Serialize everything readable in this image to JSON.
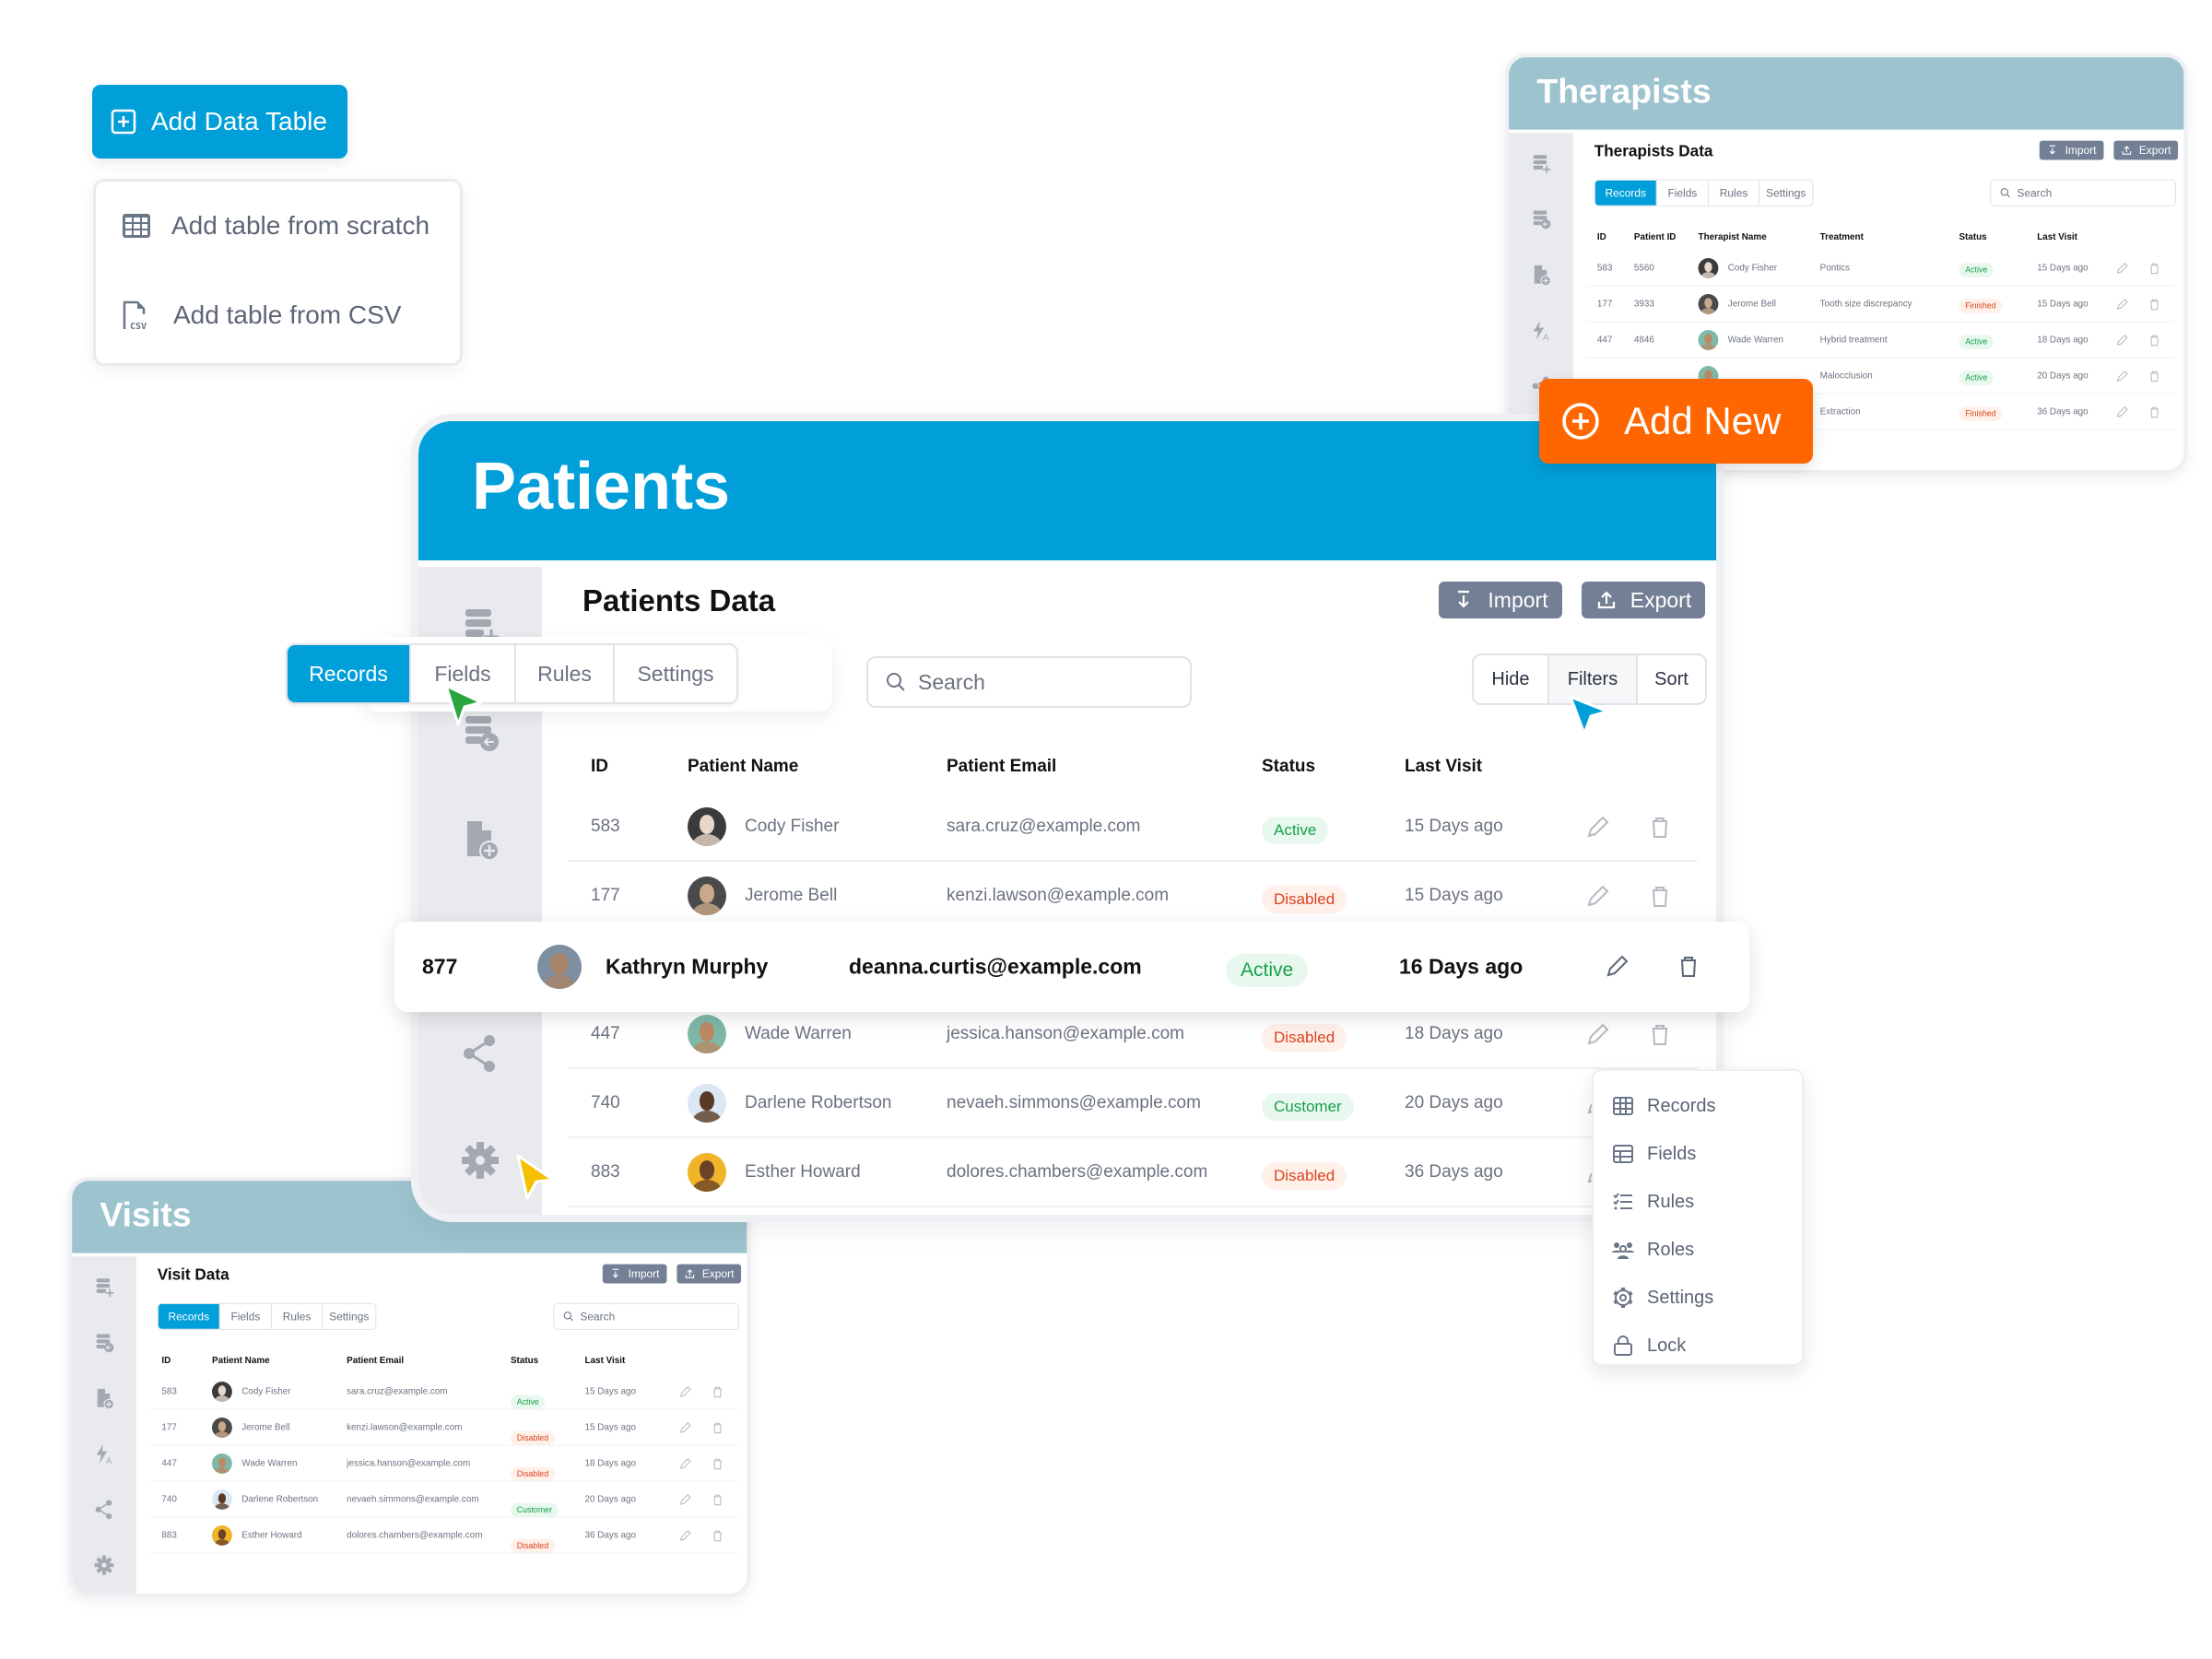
{
  "colors": {
    "primary": "#009fd9",
    "mini_header": "#9dc3cf",
    "accent_orange": "#ff6600",
    "secondary_button": "#737f94",
    "status_green": "#16a04a",
    "status_red": "#d9441f"
  },
  "add_table": {
    "label": "Add Data Table",
    "icon": "plus-square-icon",
    "menu": [
      {
        "label": "Add table from scratch",
        "icon": "table-grid-icon"
      },
      {
        "label": "Add table from CSV",
        "icon": "csv-file-icon"
      }
    ]
  },
  "add_new": {
    "label": "Add New",
    "icon": "plus-circle-icon"
  },
  "panels": {
    "therapists": {
      "title": "Therapists",
      "data_title": "Therapists Data",
      "import": "Import",
      "export": "Export",
      "tabs": [
        "Records",
        "Fields",
        "Rules",
        "Settings"
      ],
      "active_tab": "Records",
      "search_placeholder": "Search",
      "columns": [
        "ID",
        "Patient ID",
        "Therapist Name",
        "Treatment",
        "Status",
        "Last Visit"
      ],
      "rows": [
        {
          "id": "583",
          "patient_id": "5560",
          "name": "Cody Fisher",
          "treatment": "Pontics",
          "status": "Active",
          "last_visit": "15 Days ago"
        },
        {
          "id": "177",
          "patient_id": "3933",
          "name": "Jerome Bell",
          "treatment": "Tooth size discrepancy",
          "status": "Finished",
          "last_visit": "15 Days ago"
        },
        {
          "id": "447",
          "patient_id": "4846",
          "name": "Wade Warren",
          "treatment": "Hybrid treatment",
          "status": "Active",
          "last_visit": "18 Days ago"
        },
        {
          "id": "",
          "patient_id": "",
          "name": "",
          "treatment": "Malocclusion",
          "status": "Active",
          "last_visit": "20 Days ago"
        },
        {
          "id": "",
          "patient_id": "",
          "name": "",
          "treatment": "Extraction",
          "status": "Finished",
          "last_visit": "36 Days ago"
        }
      ]
    },
    "patients": {
      "title": "Patients",
      "data_title": "Patients Data",
      "import": "Import",
      "export": "Export",
      "tabs": [
        "Records",
        "Fields",
        "Rules",
        "Settings"
      ],
      "active_tab": "Records",
      "search_placeholder": "Search",
      "view_controls": [
        "Hide",
        "Filters",
        "Sort"
      ],
      "active_view_control": "Filters",
      "columns": [
        "ID",
        "Patient Name",
        "Patient Email",
        "Status",
        "Last Visit"
      ],
      "rows": [
        {
          "id": "583",
          "name": "Cody Fisher",
          "email": "sara.cruz@example.com",
          "status": "Active",
          "last_visit": "15 Days ago"
        },
        {
          "id": "177",
          "name": "Jerome Bell",
          "email": "kenzi.lawson@example.com",
          "status": "Disabled",
          "last_visit": "15 Days ago"
        },
        {
          "id": "877",
          "name": "Kathryn Murphy",
          "email": "deanna.curtis@example.com",
          "status": "Active",
          "last_visit": "16 Days ago",
          "highlighted": true
        },
        {
          "id": "447",
          "name": "Wade Warren",
          "email": "jessica.hanson@example.com",
          "status": "Disabled",
          "last_visit": "18 Days ago"
        },
        {
          "id": "740",
          "name": "Darlene Robertson",
          "email": "nevaeh.simmons@example.com",
          "status": "Customer",
          "last_visit": "20 Days ago"
        },
        {
          "id": "883",
          "name": "Esther Howard",
          "email": "dolores.chambers@example.com",
          "status": "Disabled",
          "last_visit": "36 Days ago"
        }
      ]
    },
    "visits": {
      "title": "Visits",
      "data_title": "Visit Data",
      "import": "Import",
      "export": "Export",
      "tabs": [
        "Records",
        "Fields",
        "Rules",
        "Settings"
      ],
      "active_tab": "Records",
      "search_placeholder": "Search",
      "columns": [
        "ID",
        "Patient Name",
        "Patient Email",
        "Status",
        "Last Visit"
      ],
      "rows": [
        {
          "id": "583",
          "name": "Cody Fisher",
          "email": "sara.cruz@example.com",
          "status": "Active",
          "last_visit": "15 Days ago"
        },
        {
          "id": "177",
          "name": "Jerome Bell",
          "email": "kenzi.lawson@example.com",
          "status": "Disabled",
          "last_visit": "15 Days ago"
        },
        {
          "id": "447",
          "name": "Wade Warren",
          "email": "jessica.hanson@example.com",
          "status": "Disabled",
          "last_visit": "18 Days ago"
        },
        {
          "id": "740",
          "name": "Darlene Robertson",
          "email": "nevaeh.simmons@example.com",
          "status": "Customer",
          "last_visit": "20 Days ago"
        },
        {
          "id": "883",
          "name": "Esther Howard",
          "email": "dolores.chambers@example.com",
          "status": "Disabled",
          "last_visit": "36 Days ago"
        }
      ]
    }
  },
  "sidebar_icons": [
    "add-table-icon",
    "import-table-icon",
    "add-file-icon",
    "automation-icon",
    "share-icon",
    "gear-icon"
  ],
  "context_menu": [
    {
      "label": "Records",
      "icon": "table-grid-icon"
    },
    {
      "label": "Fields",
      "icon": "fields-table-icon"
    },
    {
      "label": "Rules",
      "icon": "checklist-icon"
    },
    {
      "label": "Roles",
      "icon": "users-icon"
    },
    {
      "label": "Settings",
      "icon": "gear-icon"
    },
    {
      "label": "Lock",
      "icon": "lock-icon"
    }
  ],
  "cursors": [
    {
      "color": "#2aa63f",
      "target": "Fields"
    },
    {
      "color": "#009fd9",
      "target": "Filters"
    },
    {
      "color": "#f5c000",
      "target": "gear-icon"
    }
  ]
}
